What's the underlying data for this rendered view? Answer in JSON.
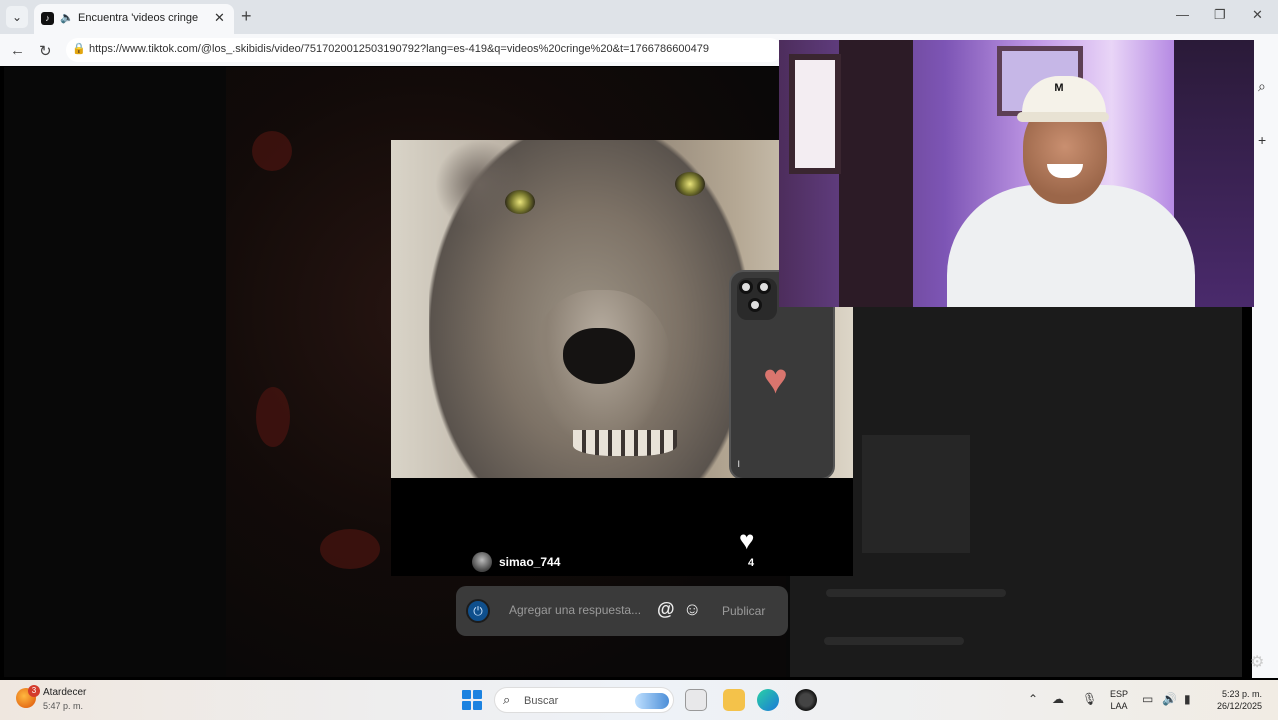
{
  "browser": {
    "tab_title": "Encuentra 'videos cringe ' en",
    "tab_favicon": "tiktok-icon",
    "new_tab_label": "+",
    "url": "https://www.tiktok.com/@los_.skibidis/video/7517020012503190792?lang=es-419&q=videos%20cringe%20&t=1766786600479",
    "window_controls": [
      "—",
      "❐",
      "✕"
    ]
  },
  "video": {
    "username": "simao_744",
    "like_count": "4",
    "reply_placeholder": "Agregar una respuesta...",
    "publish_label": "Publicar",
    "mention_symbol": "@",
    "emoji_symbol": "☺"
  },
  "taskbar": {
    "weather_badge": "3",
    "weather_title": "Atardecer",
    "weather_time": "5:47 p. m.",
    "search_label": "Buscar",
    "lang_line1": "ESP",
    "lang_line2": "LAA",
    "clock_time": "5:23 p. m.",
    "clock_date": "26/12/2025"
  },
  "colors": {
    "accent_blue": "#1b82e0",
    "heart_pink": "#d9756e"
  }
}
